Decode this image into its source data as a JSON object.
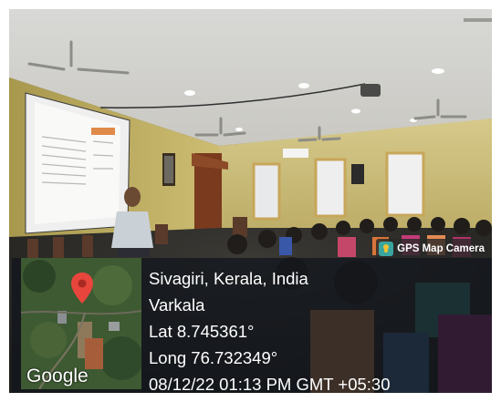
{
  "badge": {
    "label": "GPS Map Camera",
    "icon": "gps-map-camera-icon"
  },
  "map": {
    "provider_logo": "Google",
    "pin_icon": "location-pin-icon",
    "pin_color": "#e8453c"
  },
  "location": {
    "place": "Sivagiri, Kerala, India",
    "locality": "Varkala",
    "lat": "Lat 8.745361°",
    "long": "Long 76.732349°",
    "timestamp": "08/12/22 01:13 PM GMT +05:30"
  }
}
